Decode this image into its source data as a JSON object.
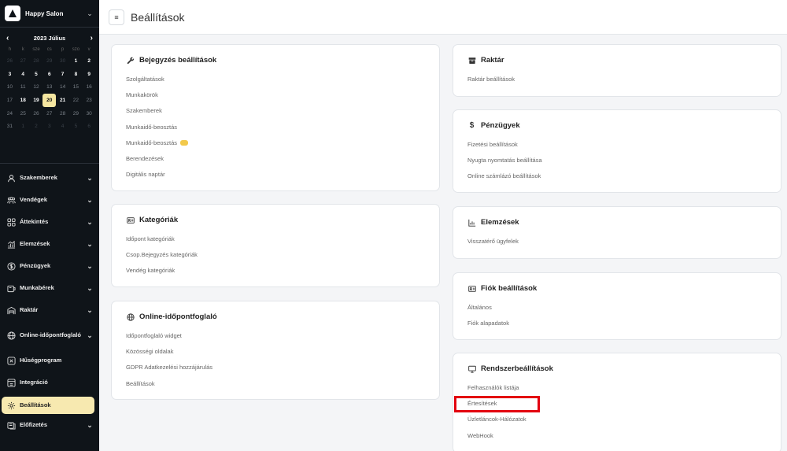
{
  "brand": {
    "name": "Happy Salon"
  },
  "calendar": {
    "month_label": "2023 Július",
    "weekdays": [
      "h",
      "k",
      "sze",
      "cs",
      "p",
      "szo",
      "v"
    ],
    "days": [
      [
        "26",
        "27",
        "28",
        "29",
        "30",
        "1",
        "2"
      ],
      [
        "3",
        "4",
        "5",
        "6",
        "7",
        "8",
        "9"
      ],
      [
        "10",
        "11",
        "12",
        "13",
        "14",
        "15",
        "16"
      ],
      [
        "17",
        "18",
        "19",
        "20",
        "21",
        "22",
        "23"
      ],
      [
        "24",
        "25",
        "26",
        "27",
        "28",
        "29",
        "30"
      ],
      [
        "31",
        "1",
        "2",
        "3",
        "4",
        "5",
        "6"
      ]
    ],
    "today": "20"
  },
  "sidebar": {
    "items": [
      {
        "label": "Szakemberek",
        "icon": "person-icon"
      },
      {
        "label": "Vendégek",
        "icon": "people-icon"
      },
      {
        "label": "Áttekintés",
        "icon": "grid-icon"
      },
      {
        "label": "Elemzések",
        "icon": "chart-icon"
      },
      {
        "label": "Pénzügyek",
        "icon": "dollar-icon"
      },
      {
        "label": "Munkabérek",
        "icon": "wallet-icon"
      },
      {
        "label": "Raktár",
        "icon": "warehouse-icon"
      },
      {
        "label": "Online-időpontfoglaló",
        "icon": "globe-icon"
      },
      {
        "label": "Hűségprogram",
        "icon": "loyalty-icon"
      },
      {
        "label": "Integráció",
        "icon": "integration-icon"
      },
      {
        "label": "Beállítások",
        "icon": "gear-icon"
      },
      {
        "label": "Előfizetés",
        "icon": "subscription-icon"
      }
    ]
  },
  "header": {
    "title": "Beállítások",
    "menu_icon": "≡"
  },
  "cards": {
    "bejegyzes": {
      "title": "Bejegyzés beállítások",
      "links": [
        "Szolgáltatások",
        "Munkakörök",
        "Szakemberek",
        "Munkaidő-beosztás",
        "Munkaidő-beosztás",
        "Berendezések",
        "Digitális naptár"
      ]
    },
    "kategoriak": {
      "title": "Kategóriák",
      "links": [
        "Időpont kategóriák",
        "Csop.Bejegyzés kategóriák",
        "Vendég kategóriák"
      ]
    },
    "online": {
      "title": "Online-időpontfoglaló",
      "links": [
        "Időpontfoglaló widget",
        "Közösségi oldalak",
        "GDPR Adatkezelési hozzájárulás",
        "Beállítások"
      ]
    },
    "raktar": {
      "title": "Raktár",
      "links": [
        "Raktár beállítások"
      ]
    },
    "penzugyek": {
      "title": "Pénzügyek",
      "links": [
        "Fizetési beállítások",
        "Nyugta nyomtatás beállítása",
        "Online számlázó beállítások"
      ]
    },
    "elemzesek": {
      "title": "Elemzések",
      "links": [
        "Visszatérő ügyfelek"
      ]
    },
    "fiok": {
      "title": "Fiók beállítások",
      "links": [
        "Általános",
        "Fiók alapadatok"
      ]
    },
    "rendszer": {
      "title": "Rendszerbeállítások",
      "links": [
        "Felhasználók listája",
        "Értesítések",
        "Üzletláncok-Hálózatok",
        "WebHook"
      ]
    }
  },
  "colors": {
    "sidebar_bg": "#0f1419",
    "active_bg": "#f7e9b0",
    "highlight": "#e3000f",
    "badge": "#f2c94c"
  }
}
